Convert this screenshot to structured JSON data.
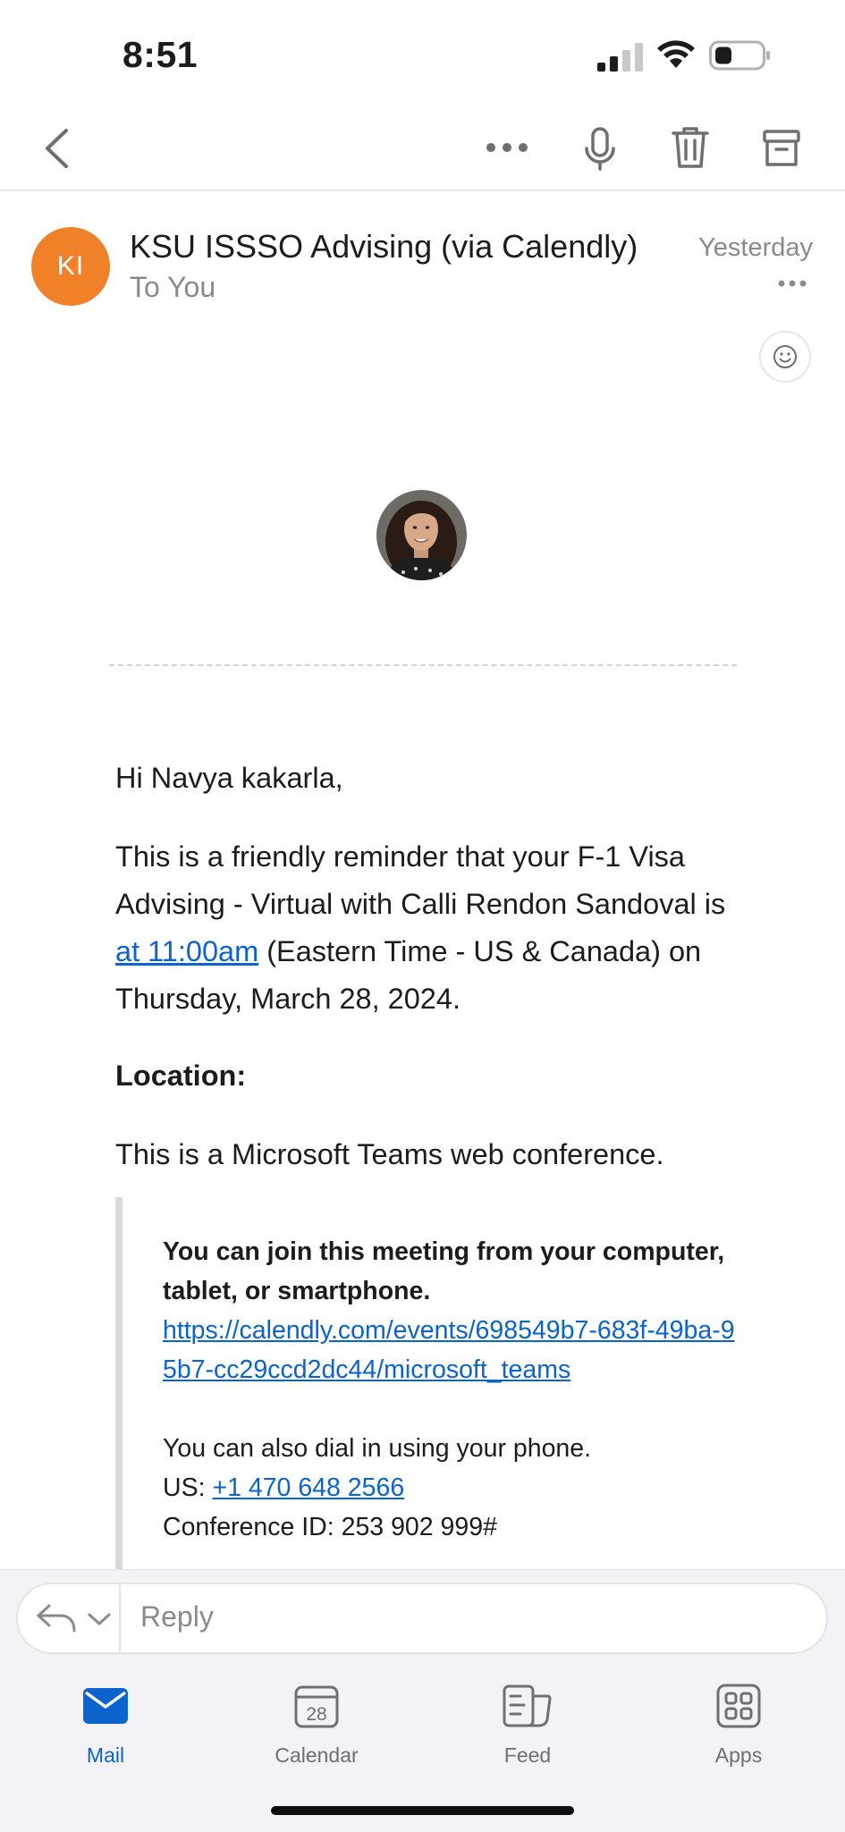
{
  "status_bar": {
    "time": "8:51"
  },
  "toolbar": {
    "back_icon": "chevron-left-icon",
    "more_icon": "more-horizontal-icon",
    "mic_icon": "microphone-icon",
    "trash_icon": "trash-icon",
    "archive_icon": "archive-icon"
  },
  "header": {
    "avatar_initials": "KI",
    "avatar_color": "#f08128",
    "sender": "KSU ISSSO Advising (via Calendly)",
    "recipient": "To You",
    "date": "Yesterday"
  },
  "body": {
    "greeting": "Hi Navya kakarla,",
    "reminder_pre": "This is a friendly reminder that your F-1 Visa Advising - Virtual with Calli Rendon Sandoval is ",
    "reminder_time_link": "at 11:00am",
    "reminder_post": " (Eastern Time - US & Canada) on Thursday, March 28, 2024.",
    "location_heading": "Location:",
    "teams_line": "This is a Microsoft Teams web conference.",
    "join_bold": "You can join this meeting from your computer, tablet, or smartphone.",
    "join_link": "https://calendly.com/events/698549b7-683f-49ba-95b7-cc29ccd2dc44/microsoft_teams",
    "dial_text": "You can also dial in using your phone.",
    "us_label": "US: ",
    "us_phone": "+1 470 648 2566",
    "conference_id": "Conference ID: 253 902 999#"
  },
  "reply": {
    "placeholder": "Reply"
  },
  "tabs": [
    {
      "label": "Mail",
      "icon": "mail-icon",
      "active": true
    },
    {
      "label": "Calendar",
      "icon": "calendar-icon",
      "day": "28"
    },
    {
      "label": "Feed",
      "icon": "feed-icon"
    },
    {
      "label": "Apps",
      "icon": "apps-icon"
    }
  ],
  "colors": {
    "accent": "#0b63ce",
    "link": "#0b63ce"
  }
}
